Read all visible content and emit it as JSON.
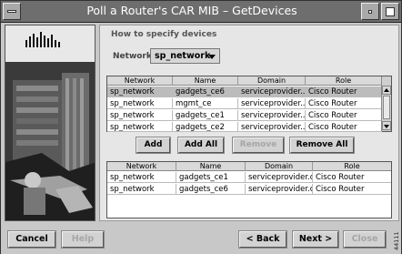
{
  "window": {
    "title": "Poll a Router's CAR MIB – GetDevices"
  },
  "main": {
    "heading": "How to specify devices",
    "network_label": "Network:",
    "network_value": "sp_network"
  },
  "available_table": {
    "columns": [
      "Network",
      "Name",
      "Domain",
      "Role"
    ],
    "rows": [
      [
        "sp_network",
        "gadgets_ce6",
        "serviceprovider...",
        "Cisco Router"
      ],
      [
        "sp_network",
        "mgmt_ce",
        "serviceprovider...",
        "Cisco Router"
      ],
      [
        "sp_network",
        "gadgets_ce1",
        "serviceprovider...",
        "Cisco Router"
      ],
      [
        "sp_network",
        "gadgets_ce2",
        "serviceprovider...",
        "Cisco Router"
      ]
    ],
    "selected_row": 1
  },
  "action_buttons": {
    "add": "Add",
    "add_all": "Add All",
    "remove": "Remove",
    "remove_all": "Remove All"
  },
  "selected_table": {
    "columns": [
      "Network",
      "Name",
      "Domain",
      "Role"
    ],
    "rows": [
      [
        "sp_network",
        "gadgets_ce1",
        "serviceprovider.c...",
        "Cisco Router"
      ],
      [
        "sp_network",
        "gadgets_ce6",
        "serviceprovider.c...",
        "Cisco Router"
      ]
    ]
  },
  "footer": {
    "cancel": "Cancel",
    "help": "Help",
    "back": "< Back",
    "next": "Next >",
    "close": "Close"
  },
  "figure_code": "44111",
  "colors": {
    "window_bg": "#c8c8c8",
    "titlebar": "#6e6e6e",
    "content_bg": "#e6e6e6",
    "selected_row": "#bcbcbc",
    "disabled_text": "#a6a6a6"
  },
  "icons": {
    "window_menu": "window-menu-icon",
    "minimize": "minimize-icon",
    "maximize": "maximize-icon",
    "dropdown": "chevron-down-icon",
    "scroll_up": "scroll-up-arrow-icon",
    "scroll_down": "scroll-down-arrow-icon"
  }
}
